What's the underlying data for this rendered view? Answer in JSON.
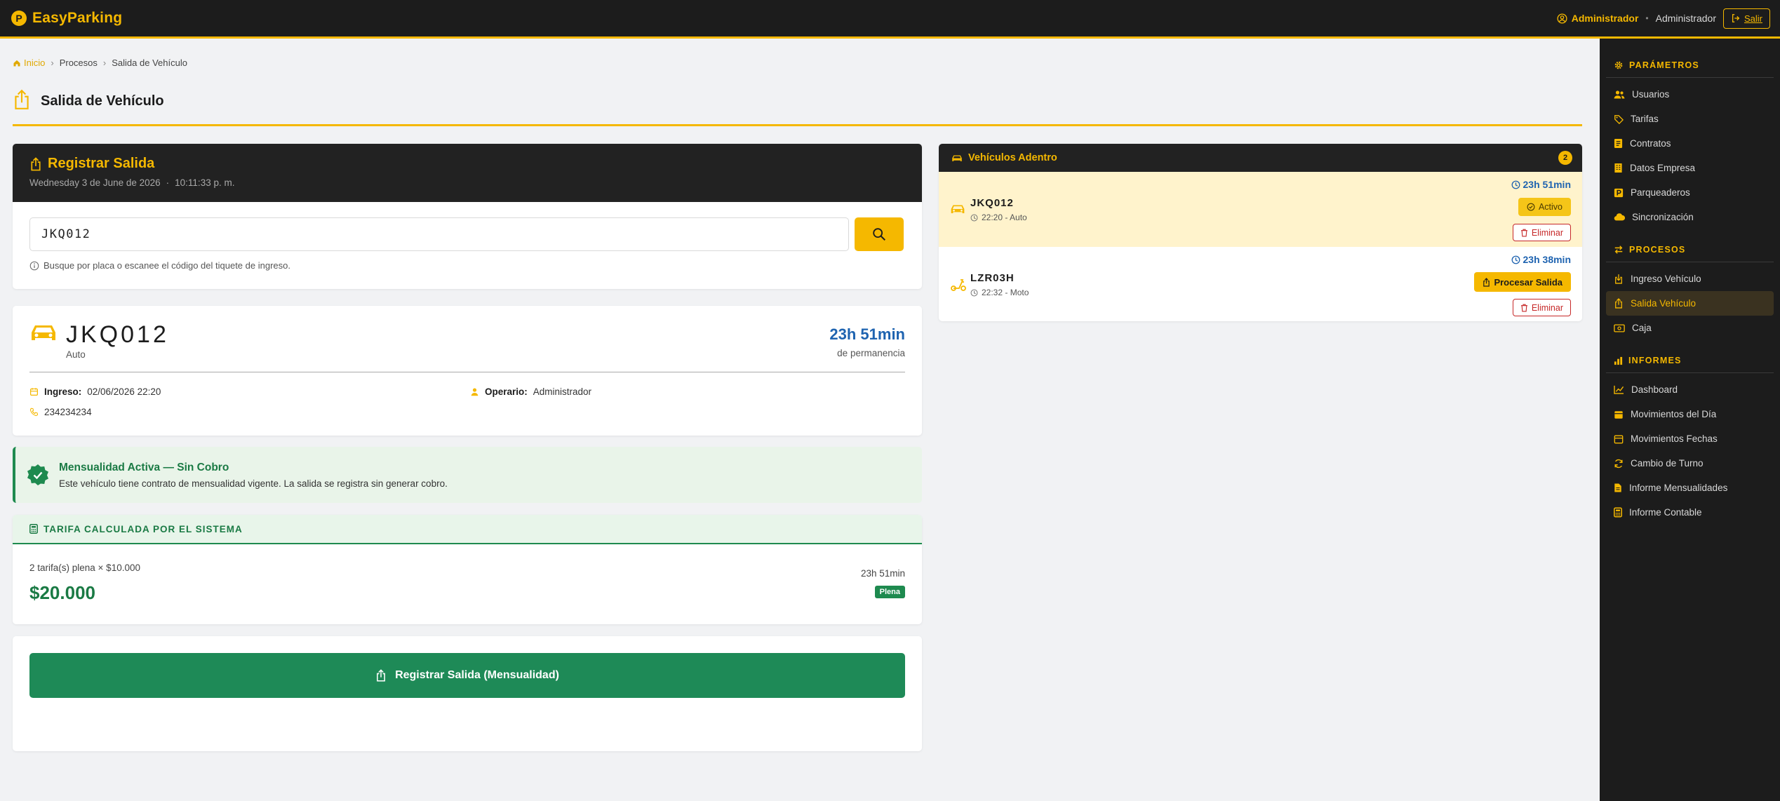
{
  "brand": {
    "badge": "P",
    "name": "EasyParking"
  },
  "user": {
    "role": "Administrador",
    "name": "Administrador",
    "logout_label": "Salir"
  },
  "breadcrumb": {
    "home": "Inicio",
    "section": "Procesos",
    "current": "Salida de Vehículo"
  },
  "page": {
    "title": "Salida de Vehículo"
  },
  "register": {
    "title": "Registrar Salida",
    "date": "Wednesday 3 de June de 2026",
    "time": "10:11:33 p. m.",
    "search_value": "JKQ012",
    "hint": "Busque por placa o escanee el código del tiquete de ingreso."
  },
  "vehicle": {
    "plate": "JKQ012",
    "type": "Auto",
    "duration": "23h 51min",
    "duration_label": "de permanencia",
    "entry_label": "Ingreso:",
    "entry_value": "02/06/2026 22:20",
    "operator_label": "Operario:",
    "operator_value": "Administrador",
    "phone": "234234234"
  },
  "alert": {
    "title": "Mensualidad Activa — Sin Cobro",
    "text": "Este vehículo tiene contrato de mensualidad vigente. La salida se registra sin generar cobro."
  },
  "tarifa": {
    "header": "TARIFA CALCULADA POR EL SISTEMA",
    "detail": "2 tarifa(s) plena × $10.000",
    "total": "$20.000",
    "time": "23h 51min",
    "badge": "Plena"
  },
  "submit": {
    "label": "Registrar Salida (Mensualidad)"
  },
  "inside": {
    "title": "Vehículos Adentro",
    "count": "2",
    "rows": [
      {
        "plate": "JKQ012",
        "meta": "22:20 - Auto",
        "duration": "23h 51min",
        "action": "Activo",
        "delete": "Eliminar"
      },
      {
        "plate": "LZR03H",
        "meta": "22:32 - Moto",
        "duration": "23h 38min",
        "action": "Procesar Salida",
        "delete": "Eliminar"
      }
    ]
  },
  "sidebar": {
    "sections": [
      {
        "title": "PARÁMETROS",
        "items": [
          "Usuarios",
          "Tarifas",
          "Contratos",
          "Datos Empresa",
          "Parqueaderos",
          "Sincronización"
        ]
      },
      {
        "title": "PROCESOS",
        "items": [
          "Ingreso Vehículo",
          "Salida Vehículo",
          "Caja"
        ]
      },
      {
        "title": "INFORMES",
        "items": [
          "Dashboard",
          "Movimientos del Día",
          "Movimientos Fechas",
          "Cambio de Turno",
          "Informe Mensualidades",
          "Informe Contable"
        ]
      }
    ],
    "active_item": "Salida Vehículo"
  },
  "colors": {
    "accent": "#f5b800",
    "dark": "#1c1c1c",
    "success": "#1e8a4f",
    "info": "#1e63b0",
    "danger": "#c62828"
  }
}
